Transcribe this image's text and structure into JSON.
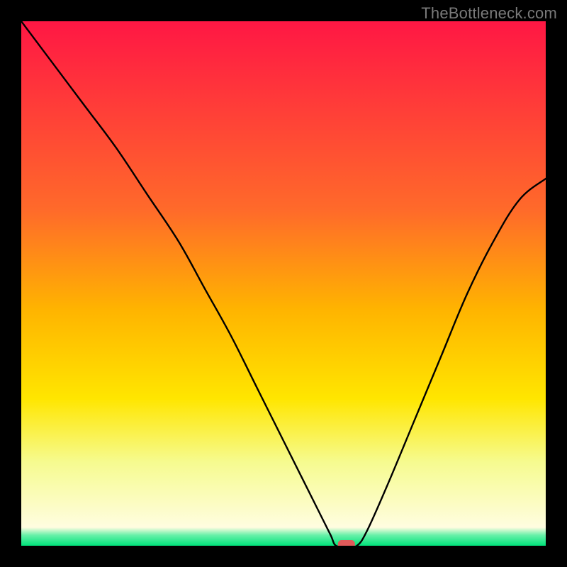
{
  "watermark": "TheBottleneck.com",
  "chart_data": {
    "type": "line",
    "title": "",
    "xlabel": "",
    "ylabel": "",
    "xlim": [
      0,
      100
    ],
    "ylim": [
      0,
      100
    ],
    "grid": false,
    "legend": false,
    "marker": {
      "x": 62,
      "y": 0,
      "color": "#e05a5a",
      "shape": "rounded-rect"
    },
    "gradient_stops": [
      {
        "pos": 0,
        "color": "#ff1744"
      },
      {
        "pos": 0.36,
        "color": "#ff6a2a"
      },
      {
        "pos": 0.55,
        "color": "#ffb400"
      },
      {
        "pos": 0.72,
        "color": "#ffe600"
      },
      {
        "pos": 0.84,
        "color": "#f6fb8f"
      },
      {
        "pos": 0.965,
        "color": "#fffde0"
      },
      {
        "pos": 0.98,
        "color": "#66f0a8"
      },
      {
        "pos": 1,
        "color": "#00e37a"
      }
    ],
    "series": [
      {
        "name": "bottleneck-curve",
        "x": [
          0,
          6,
          12,
          18,
          24,
          30,
          35,
          40,
          45,
          50,
          54,
          57,
          59,
          60,
          62,
          64,
          66,
          70,
          75,
          80,
          85,
          90,
          95,
          100
        ],
        "y": [
          100,
          92,
          84,
          76,
          67,
          58,
          49,
          40,
          30,
          20,
          12,
          6,
          2,
          0,
          0,
          0,
          3,
          12,
          24,
          36,
          48,
          58,
          66,
          70
        ]
      }
    ]
  }
}
